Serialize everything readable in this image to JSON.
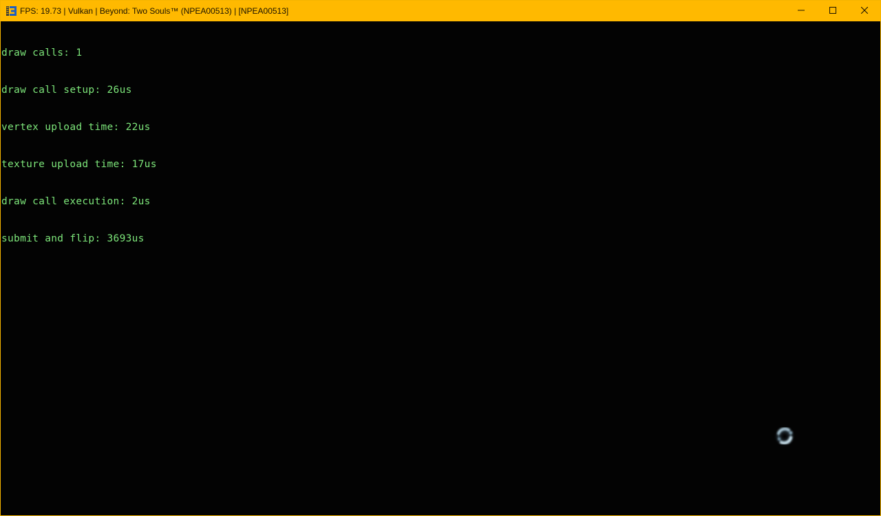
{
  "window": {
    "title": "FPS: 19.73 | Vulkan | Beyond: Two Souls™ (NPEA00513) | [NPEA00513]",
    "app_icon": "rpcs3-app-icon",
    "controls": {
      "minimize": "minimize-icon",
      "maximize": "maximize-icon",
      "close": "close-icon"
    },
    "accent_color": "#ffb900"
  },
  "overlay": {
    "text_color": "#7de67a",
    "lines": [
      "draw calls: 1",
      "draw call setup: 26us",
      "vertex upload time: 22us",
      "texture upload time: 17us",
      "draw call execution: 2us",
      "submit and flip: 3693us"
    ]
  },
  "loading_indicator": {
    "icon": "loading-spinner-icon"
  }
}
